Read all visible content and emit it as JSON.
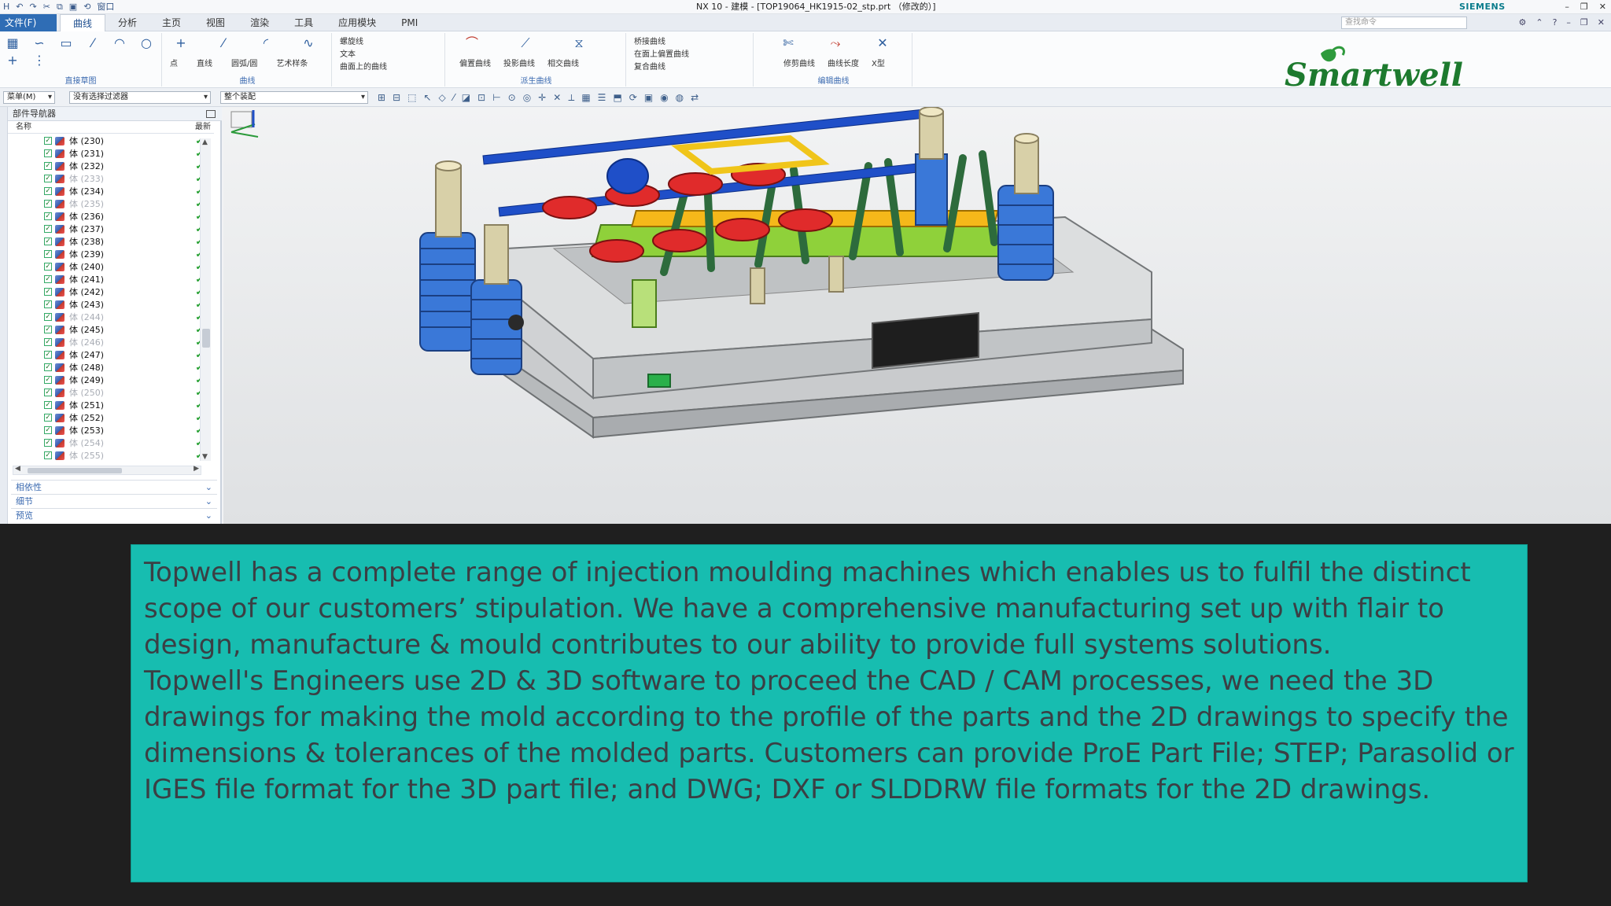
{
  "window": {
    "title": "NX 10 - 建模 - [TOP19064_HK1915-02_stp.prt （修改的）]",
    "brand": "SIEMENS",
    "quick_access": [
      "H",
      "↶",
      "↷",
      "✂",
      "⧉",
      "▣",
      "⟲",
      "窗口"
    ]
  },
  "menu": {
    "file_label": "文件(F)",
    "tabs": [
      "曲线",
      "分析",
      "主页",
      "视图",
      "渲染",
      "工具",
      "应用模块",
      "PMI"
    ],
    "active_tab": "曲线",
    "search_placeholder": "查找命令"
  },
  "ribbon": {
    "groups": [
      {
        "title": "直接草图",
        "labels": [
          "草图",
          "",
          "",
          ""
        ]
      },
      {
        "title": "曲线",
        "labels": [
          "点",
          "直线",
          "圆弧/圆",
          "艺术样条"
        ]
      },
      {
        "title": "",
        "list": [
          "螺旋线",
          "文本",
          "曲面上的曲线"
        ]
      },
      {
        "title": "派生曲线",
        "labels": [
          "偏置曲线",
          "投影曲线",
          "相交曲线"
        ]
      },
      {
        "title": "",
        "list": [
          "桥接曲线",
          "在面上偏置曲线",
          "复合曲线"
        ]
      },
      {
        "title": "编辑曲线",
        "labels": [
          "修剪曲线",
          "曲线长度",
          "X型"
        ]
      }
    ]
  },
  "toolbar": {
    "menu_label": "菜单(M)",
    "filter_value": "没有选择过滤器",
    "assembly_value": "整个装配"
  },
  "logo": {
    "text": "Smartwell"
  },
  "navigator": {
    "title": "部件导航器",
    "col_name": "名称",
    "col_status": "最新",
    "rows": [
      {
        "label": "体 (230)",
        "dim": false
      },
      {
        "label": "体 (231)",
        "dim": false
      },
      {
        "label": "体 (232)",
        "dim": false
      },
      {
        "label": "体 (233)",
        "dim": true
      },
      {
        "label": "体 (234)",
        "dim": false
      },
      {
        "label": "体 (235)",
        "dim": true
      },
      {
        "label": "体 (236)",
        "dim": false
      },
      {
        "label": "体 (237)",
        "dim": false
      },
      {
        "label": "体 (238)",
        "dim": false
      },
      {
        "label": "体 (239)",
        "dim": false
      },
      {
        "label": "体 (240)",
        "dim": false
      },
      {
        "label": "体 (241)",
        "dim": false
      },
      {
        "label": "体 (242)",
        "dim": false
      },
      {
        "label": "体 (243)",
        "dim": false
      },
      {
        "label": "体 (244)",
        "dim": true
      },
      {
        "label": "体 (245)",
        "dim": false
      },
      {
        "label": "体 (246)",
        "dim": true
      },
      {
        "label": "体 (247)",
        "dim": false
      },
      {
        "label": "体 (248)",
        "dim": false
      },
      {
        "label": "体 (249)",
        "dim": false
      },
      {
        "label": "体 (250)",
        "dim": true
      },
      {
        "label": "体 (251)",
        "dim": false
      },
      {
        "label": "体 (252)",
        "dim": false
      },
      {
        "label": "体 (253)",
        "dim": false
      },
      {
        "label": "体 (254)",
        "dim": true
      },
      {
        "label": "体 (255)",
        "dim": true
      }
    ],
    "panels": [
      "相依性",
      "细节",
      "预览"
    ]
  },
  "caption": {
    "paragraph_1": "Topwell has a complete range of injection moulding machines which enables us to fulfil the distinct scope of our customers’ stipulation. We have a comprehensive manufacturing set up with flair to design, manufacture & mould contributes to our ability to provide full systems solutions.",
    "paragraph_2": "Topwell's Engineers use 2D & 3D software to proceed the CAD / CAM processes, we need the 3D drawings for making the mold according to the profile of the parts and the 2D drawings to specify the dimensions & tolerances of the molded parts. Customers can provide ProE Part File; STEP; Parasolid or IGES file format for the 3D part file; and DWG; DXF or SLDDRW file formats for the 2D drawings."
  },
  "colors": {
    "caption_bg": "#17bdb0",
    "caption_text": "#3b3f44",
    "logo_green": "#1d7a2e",
    "active_menu": "#2f6db5"
  }
}
